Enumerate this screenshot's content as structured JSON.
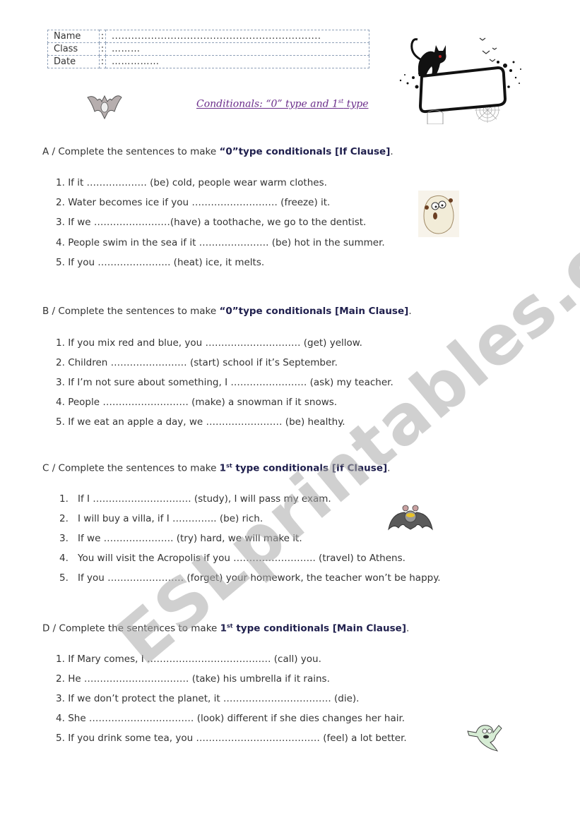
{
  "header_table": [
    {
      "label": "Name",
      "colon": ":",
      "value": "................................................................"
    },
    {
      "label": "Class",
      "colon": ":",
      "value": "………"
    },
    {
      "label": "Date",
      "colon": ":",
      "value": "……………"
    }
  ],
  "title": {
    "text_a": "Conditionals: “0” type and 1",
    "sup": "st",
    "text_b": " type"
  },
  "watermark": "ESLprintables.com",
  "sections": [
    {
      "id": "A",
      "heading_plain": "A / Complete the sentences to make ",
      "heading_bold_a": "“0”type conditionals [If Clause]",
      "heading_sup": "",
      "heading_bold_b": "",
      "heading_end": ".",
      "items": [
        {
          "num": "1.",
          "text": "If it ………………. (be) cold, people wear warm clothes."
        },
        {
          "num": "2.",
          "text": "Water becomes ice if you ……………………… (freeze) it."
        },
        {
          "num": "3.",
          "text": "If we ……………………(have) a toothache, we go to the dentist."
        },
        {
          "num": "4.",
          "text": "People  swim in the sea if it  …………………. (be) hot in the summer."
        },
        {
          "num": "5.",
          "text": "If you ………………….. (heat) ice, it melts."
        }
      ]
    },
    {
      "id": "B",
      "heading_plain": "B / Complete the sentences to make ",
      "heading_bold_a": "“0”type conditionals [Main Clause]",
      "heading_sup": "",
      "heading_bold_b": "",
      "heading_end": ".",
      "items": [
        {
          "num": "1.",
          "text": "If you mix red and blue, you ………………………… (get) yellow."
        },
        {
          "num": "2.",
          "text": "Children …………………… (start) school if it’s September."
        },
        {
          "num": "3.",
          "text": "If I’m not sure about something, I …………………… (ask) my teacher."
        },
        {
          "num": "4.",
          "text": "People ……………………… (make) a snowman if it snows."
        },
        {
          "num": "5.",
          "text": "If we eat an apple a day, we  …………………… (be) healthy."
        }
      ]
    },
    {
      "id": "C",
      "heading_plain": "C / Complete the sentences to make ",
      "heading_bold_a": "1",
      "heading_sup": "st",
      "heading_bold_b": " type conditionals [If Clause]",
      "heading_end": ".",
      "items": [
        {
          "num": "1.",
          "text": "If I …………………………. (study), I will pass my exam."
        },
        {
          "num": "2.",
          "text": "I will buy a villa, if I ………….. (be) rich."
        },
        {
          "num": "3.",
          "text": "If we …………………. (try) hard, we will make it."
        },
        {
          "num": "4.",
          "text": "You will visit the Acropolis if you …………………….. (travel) to Athens."
        },
        {
          "num": "5.",
          "text": "If you …………………… (forget) your homework, the teacher won’t be happy."
        }
      ]
    },
    {
      "id": "D",
      "heading_plain": "D / Complete the sentences to make ",
      "heading_bold_a": "1",
      "heading_sup": "st",
      "heading_bold_b": " type conditionals [Main Clause]",
      "heading_end": ".",
      "items": [
        {
          "num": "1.",
          "text": "If Mary comes, I ………………………………… (call) you."
        },
        {
          "num": "2.",
          "text": "He …………………………… (take) his umbrella if it rains."
        },
        {
          "num": "3.",
          "text": "If we don’t protect the planet, it ……………………………. (die)."
        },
        {
          "num": "4.",
          "text": "She …………………………… (look) different if she dies changes her hair."
        },
        {
          "num": "5.",
          "text": "If you drink some tea, you ………………………………… (feel) a lot better."
        }
      ]
    }
  ]
}
